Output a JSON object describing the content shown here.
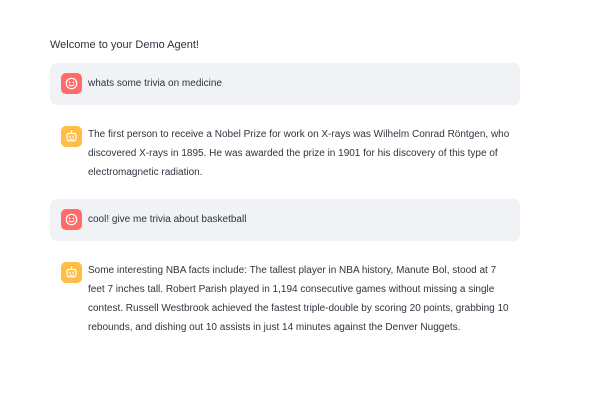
{
  "header": {
    "welcome": "Welcome to your Demo Agent!"
  },
  "messages": [
    {
      "role": "user",
      "avatar_icon": "smile-face-icon",
      "text": "whats some trivia on medicine"
    },
    {
      "role": "assistant",
      "avatar_icon": "robot-icon",
      "text": "The first person to receive a Nobel Prize for work on X-rays was Wilhelm Conrad Röntgen, who discovered X-rays in 1895. He was awarded the prize in 1901 for his discovery of this type of electromagnetic radiation."
    },
    {
      "role": "user",
      "avatar_icon": "smile-face-icon",
      "text": "cool! give me trivia about basketball"
    },
    {
      "role": "assistant",
      "avatar_icon": "robot-icon",
      "text": "Some interesting NBA facts include: The tallest player in NBA history, Manute Bol, stood at 7 feet 7 inches tall. Robert Parish played in 1,194 consecutive games without missing a single contest. Russell Westbrook achieved the fastest triple-double by scoring 20 points, grabbing 10 rebounds, and dishing out 10 assists in just 14 minutes against the Denver Nuggets."
    }
  ],
  "colors": {
    "user_avatar": "#ff6b6b",
    "assistant_avatar": "#ffbd45",
    "user_bubble": "#f0f2f6",
    "text": "#31333f"
  }
}
